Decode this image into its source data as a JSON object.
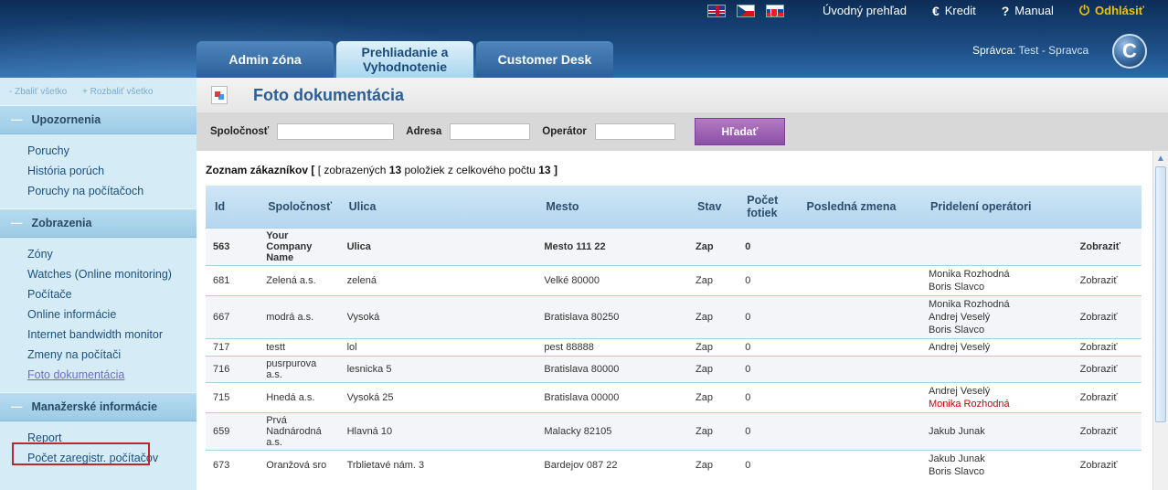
{
  "header": {
    "flags": [
      "flag-uk",
      "flag-cz",
      "flag-sk"
    ],
    "nav": [
      {
        "label": "Úvodný prehľad",
        "icon": ""
      },
      {
        "label": "Kredit",
        "icon": "euro-icon"
      },
      {
        "label": "Manual",
        "icon": "question-icon"
      },
      {
        "label": "Odhlásiť",
        "icon": "power-icon"
      }
    ],
    "tabs": [
      "Admin zóna",
      "Prehliadanie a Vyhodnotenie",
      "Customer Desk"
    ],
    "admin_prefix": "Správca:",
    "admin_name": "Test - Spravca",
    "logo_letter": "C"
  },
  "sidebar": {
    "collapse_all": "- Zbaliť všetko",
    "expand_all": "+ Rozbaliť všetko",
    "sections": [
      {
        "title": "Upozornenia",
        "items": [
          "Poruchy",
          "História porúch",
          "Poruchy na počítačoch"
        ]
      },
      {
        "title": "Zobrazenia",
        "items": [
          "Zóny",
          "Watches (Online monitoring)",
          "Počítače",
          "Online informácie",
          "Internet bandwidth monitor",
          "Zmeny na počítači",
          "Foto dokumentácia"
        ]
      },
      {
        "title": "Manažerské informácie",
        "items": [
          "Report",
          "Počet zaregistr. počítačov"
        ]
      }
    ]
  },
  "page": {
    "title": "Foto dokumentácia",
    "filter": {
      "company_label": "Spoločnosť",
      "address_label": "Adresa",
      "operator_label": "Operátor",
      "search_button": "Hľadať"
    },
    "list_title_prefix": "Zoznam zákazníkov",
    "list_title_mid": "[ zobrazených",
    "list_count": "13",
    "list_title_mid2": "položiek z celkového počtu",
    "list_total": "13",
    "list_title_end": "]",
    "columns": [
      "Id",
      "Spoločnosť",
      "Ulica",
      "Mesto",
      "Stav",
      "Počet fotiek",
      "Posledná zmena",
      "Pridelení operátori",
      ""
    ],
    "rows": [
      {
        "id": "563",
        "company": "Your Company Name",
        "street": "Ulica",
        "city": "Mesto 111 22",
        "state": "Zap",
        "photos": "0",
        "last": "",
        "operators": [],
        "action": "Zobraziť"
      },
      {
        "id": "681",
        "company": "Zelená a.s.",
        "street": "zelená",
        "city": "Velké 80000",
        "state": "Zap",
        "photos": "0",
        "last": "",
        "operators": [
          "Monika Rozhodná",
          "Boris Slavco"
        ],
        "action": "Zobraziť"
      },
      {
        "id": "667",
        "company": "modrá a.s.",
        "street": "Vysoká",
        "city": "Bratislava 80250",
        "state": "Zap",
        "photos": "0",
        "last": "",
        "operators": [
          "Monika Rozhodná",
          "Andrej Veselý",
          "Boris Slavco"
        ],
        "action": "Zobraziť"
      },
      {
        "id": "717",
        "company": "testt",
        "street": "lol",
        "city": "pest 88888",
        "state": "Zap",
        "photos": "0",
        "last": "",
        "operators": [
          "Andrej Veselý"
        ],
        "action": "Zobraziť"
      },
      {
        "id": "716",
        "company": "pusrpurova a.s.",
        "street": "lesnicka 5",
        "city": "Bratislava 80000",
        "state": "Zap",
        "photos": "0",
        "last": "",
        "operators": [],
        "action": "Zobraziť"
      },
      {
        "id": "715",
        "company": "Hnedá a.s.",
        "street": "Vysoká 25",
        "city": "Bratislava 00000",
        "state": "Zap",
        "photos": "0",
        "last": "",
        "operators": [
          "Andrej Veselý",
          "Monika Rozhodná"
        ],
        "operator_colors": [
          "",
          "#d00000"
        ],
        "action": "Zobraziť"
      },
      {
        "id": "659",
        "company": "Prvá Nadnárodná a.s.",
        "street": "Hlavná 10",
        "city": "Malacky 82105",
        "state": "Zap",
        "photos": "0",
        "last": "",
        "operators": [
          "Jakub Junak"
        ],
        "action": "Zobraziť"
      },
      {
        "id": "673",
        "company": "Oranžová sro",
        "street": "Trblietavé nám. 3",
        "city": "Bardejov 087 22",
        "state": "Zap",
        "photos": "0",
        "last": "",
        "operators": [
          "Jakub Junak",
          "Boris Slavco"
        ],
        "action": "Zobraziť"
      }
    ]
  },
  "colors": {
    "accent": "#2c5f93",
    "search_button": "#9b5fb4",
    "highlight_red": "#d00000",
    "logout": "#f2c200"
  }
}
